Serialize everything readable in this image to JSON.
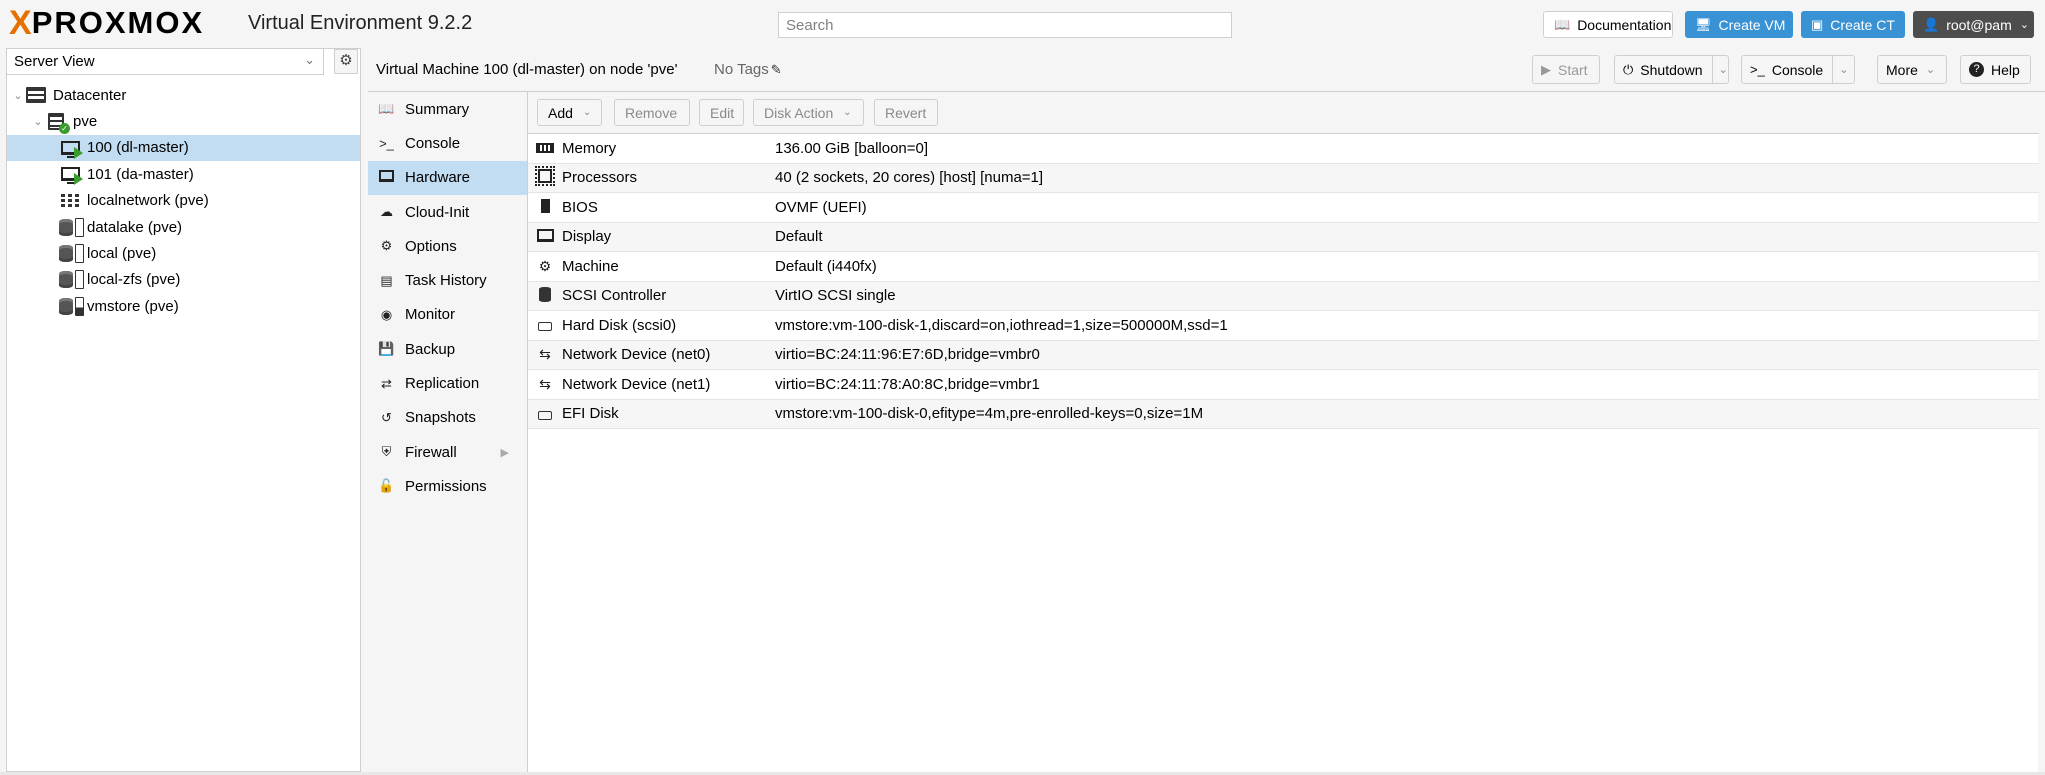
{
  "header": {
    "logo_x": "X",
    "logo_text": "PROXMOX",
    "product": "Virtual Environment 9.2.2",
    "search_placeholder": "Search",
    "documentation": "Documentation",
    "create_vm": "Create VM",
    "create_ct": "Create CT",
    "user": "root@pam"
  },
  "sidebar": {
    "view": "Server View",
    "tree": [
      {
        "label": "Datacenter",
        "level": 0,
        "icon": "datacenter-icon"
      },
      {
        "label": "pve",
        "level": 1,
        "icon": "node-online-icon"
      },
      {
        "label": "100 (dl-master)",
        "level": 2,
        "icon": "vm-running-icon",
        "selected": true
      },
      {
        "label": "101 (da-master)",
        "level": 2,
        "icon": "vm-running-icon"
      },
      {
        "label": "localnetwork (pve)",
        "level": 2,
        "icon": "network-icon"
      },
      {
        "label": "datalake (pve)",
        "level": 2,
        "icon": "storage-icon"
      },
      {
        "label": "local (pve)",
        "level": 2,
        "icon": "storage-icon"
      },
      {
        "label": "local-zfs (pve)",
        "level": 2,
        "icon": "storage-icon"
      },
      {
        "label": "vmstore (pve)",
        "level": 2,
        "icon": "storage-icon"
      }
    ]
  },
  "content": {
    "title": "Virtual Machine 100 (dl-master) on node 'pve'",
    "tags": "No Tags",
    "buttons": {
      "start": "Start",
      "shutdown": "Shutdown",
      "console": "Console",
      "more": "More",
      "help": "Help"
    }
  },
  "vm_nav": [
    {
      "label": "Summary",
      "icon": "book-icon"
    },
    {
      "label": "Console",
      "icon": "terminal-icon"
    },
    {
      "label": "Hardware",
      "icon": "desktop-icon",
      "active": true
    },
    {
      "label": "Cloud-Init",
      "icon": "cloud-icon"
    },
    {
      "label": "Options",
      "icon": "gear-icon"
    },
    {
      "label": "Task History",
      "icon": "list-icon"
    },
    {
      "label": "Monitor",
      "icon": "eye-icon"
    },
    {
      "label": "Backup",
      "icon": "floppy-icon"
    },
    {
      "label": "Replication",
      "icon": "retweet-icon"
    },
    {
      "label": "Snapshots",
      "icon": "history-icon"
    },
    {
      "label": "Firewall",
      "icon": "shield-icon",
      "expandable": true
    },
    {
      "label": "Permissions",
      "icon": "unlock-icon"
    }
  ],
  "hardware": {
    "toolbar": {
      "add": "Add",
      "remove": "Remove",
      "edit": "Edit",
      "disk_action": "Disk Action",
      "revert": "Revert"
    },
    "rows": [
      {
        "name": "Memory",
        "value": "136.00 GiB [balloon=0]",
        "icon": "memory-icon"
      },
      {
        "name": "Processors",
        "value": "40 (2 sockets, 20 cores) [host] [numa=1]",
        "icon": "cpu-icon"
      },
      {
        "name": "BIOS",
        "value": "OVMF (UEFI)",
        "icon": "microchip-icon"
      },
      {
        "name": "Display",
        "value": "Default",
        "icon": "desktop-icon"
      },
      {
        "name": "Machine",
        "value": "Default (i440fx)",
        "icon": "cogs-icon"
      },
      {
        "name": "SCSI Controller",
        "value": "VirtIO SCSI single",
        "icon": "database-icon"
      },
      {
        "name": "Hard Disk (scsi0)",
        "value": "vmstore:vm-100-disk-1,discard=on,iothread=1,size=500000M,ssd=1",
        "icon": "hdd-icon"
      },
      {
        "name": "Network Device (net0)",
        "value": "virtio=BC:24:11:96:E7:6D,bridge=vmbr0",
        "icon": "exchange-icon"
      },
      {
        "name": "Network Device (net1)",
        "value": "virtio=BC:24:11:78:A0:8C,bridge=vmbr1",
        "icon": "exchange-icon"
      },
      {
        "name": "EFI Disk",
        "value": "vmstore:vm-100-disk-0,efitype=4m,pre-enrolled-keys=0,size=1M",
        "icon": "hdd-icon"
      }
    ]
  },
  "colors": {
    "accent": "#3892d4",
    "brand_orange": "#e57000",
    "selection": "#c2ddf2",
    "running_green": "#3b9c2e"
  }
}
